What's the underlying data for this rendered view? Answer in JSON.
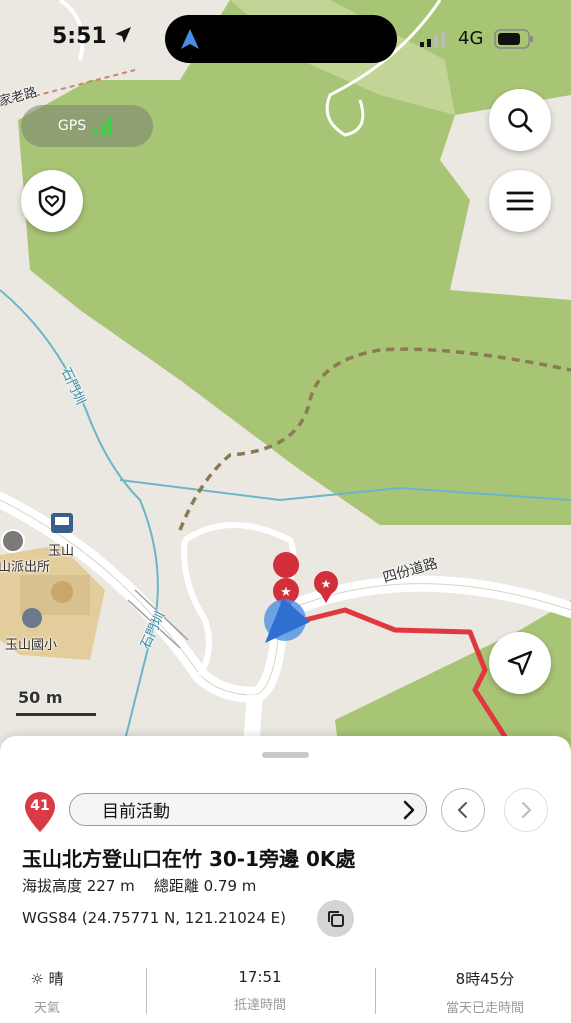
{
  "status_bar": {
    "time": "5:51",
    "carrier": "4G"
  },
  "map": {
    "labels": {
      "road_top_left": "家老路",
      "stream_1": "石門圳",
      "stream_2": "石門圳",
      "road_sifen": "四份道路",
      "police": "山派出所",
      "bus_stop": "玉山",
      "school": "玉山國小"
    },
    "gps_label": "GPS",
    "scale_label": "50 m"
  },
  "buttons": {
    "search_icon": "search-icon",
    "menu_icon": "hamburger-menu-icon",
    "shield_icon": "shield-heart-icon",
    "locate_icon": "navigation-arrow-icon"
  },
  "sheet": {
    "badge_number": "41",
    "activity_label": "目前活動",
    "place_title": "玉山北方登山口在竹 30-1旁邊 0K處",
    "stats": "海拔高度 227 m    總距離 0.79 m",
    "coords": "WGS84 (24.75771 N, 121.21024 E)",
    "info": [
      {
        "value": "晴",
        "label": "天氣"
      },
      {
        "value": "17:51",
        "label": "抵達時間"
      },
      {
        "value": "8時45分",
        "label": "當天已走時間"
      }
    ]
  },
  "colors": {
    "forest": "#a8c475",
    "route": "#e0383e",
    "stream": "#6ab5c9",
    "trail": "#8a7a55",
    "marker": "#d32f3a",
    "location": "#4a90e2"
  }
}
